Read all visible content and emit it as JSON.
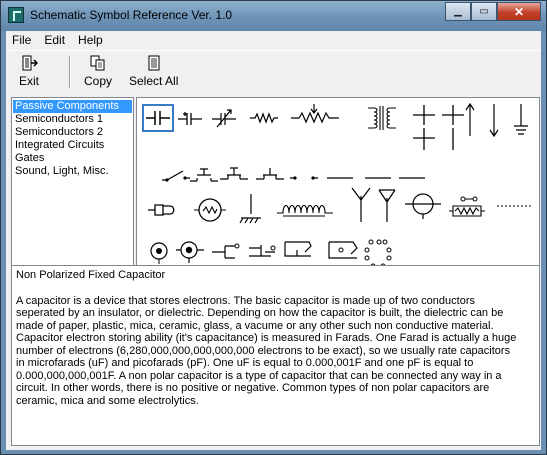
{
  "window": {
    "title": "Schematic Symbol Reference Ver. 1.0"
  },
  "menu": {
    "file": "File",
    "edit": "Edit",
    "help": "Help"
  },
  "toolbar": {
    "exit": "Exit",
    "copy": "Copy",
    "select_all": "Select All"
  },
  "categories": [
    {
      "label": "Passive Components",
      "selected": true
    },
    {
      "label": "Semiconductors 1"
    },
    {
      "label": "Semiconductors 2"
    },
    {
      "label": "Integrated Circuits"
    },
    {
      "label": "Gates"
    },
    {
      "label": "Sound, Light, Misc."
    }
  ],
  "description": {
    "title": "Non Polarized Fixed Capacitor",
    "body": "A capacitor is a device that stores electrons. The basic capacitor is made up of two conductors\nseperated by an insulator, or dielectric. Depending on how the capacitor is built, the dielectric can be\nmade of paper, plastic, mica, ceramic, glass, a vacume or any other such non conductive material.\nCapacitor electron storing ability (it's capacitance) is measured in Farads. One Farad is actually a huge\nnumber of electrons (6,280,000,000,000,000,000 electrons to be exact), so we usually rate capacitors\nin microfarads (uF) and picofarads (pF). One uF is equal to 0.000,001F and one pF is equal to\n0.000,000,000,001F. A non polar capacitor is a type of capacitor that can be connected any way in a\ncircuit. In other words, there is no positive or negative. Common types of non polar capacitors are\nceramic, mica and some electrolytics."
  },
  "icons": {
    "exit": "exit-door-icon",
    "copy": "copy-pages-icon",
    "select_all": "document-icon"
  }
}
